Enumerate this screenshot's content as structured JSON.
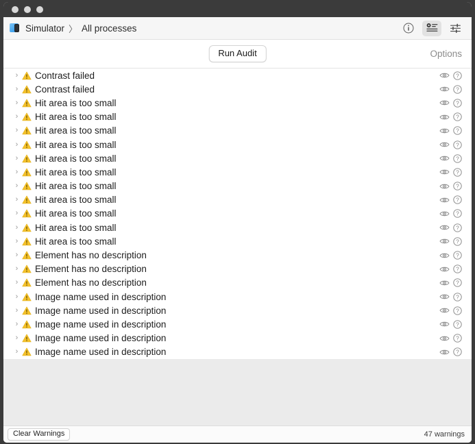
{
  "window": {
    "traffic_lights": [
      "close",
      "minimize",
      "zoom"
    ]
  },
  "toolbar": {
    "app_icon": "simulator-icon",
    "breadcrumb": {
      "app": "Simulator",
      "separator": "〉",
      "scope": "All processes"
    },
    "actions": [
      {
        "name": "info-icon",
        "label": "Info"
      },
      {
        "name": "inspector-icon",
        "label": "Inspector",
        "selected": true
      },
      {
        "name": "sliders-icon",
        "label": "Filters"
      }
    ]
  },
  "auditbar": {
    "run_audit_label": "Run Audit",
    "options_label": "Options"
  },
  "list": {
    "row_icon": "warning-triangle-icon",
    "disclosure_icon": "chevron-right-icon",
    "row_actions": [
      {
        "name": "eye-icon",
        "label": "Reveal"
      },
      {
        "name": "help-icon",
        "label": "Help"
      }
    ],
    "rows": [
      {
        "label": "Contrast failed"
      },
      {
        "label": "Contrast failed"
      },
      {
        "label": "Hit area is too small"
      },
      {
        "label": "Hit area is too small"
      },
      {
        "label": "Hit area is too small"
      },
      {
        "label": "Hit area is too small"
      },
      {
        "label": "Hit area is too small"
      },
      {
        "label": "Hit area is too small"
      },
      {
        "label": "Hit area is too small"
      },
      {
        "label": "Hit area is too small"
      },
      {
        "label": "Hit area is too small"
      },
      {
        "label": "Hit area is too small"
      },
      {
        "label": "Hit area is too small"
      },
      {
        "label": "Element has no description"
      },
      {
        "label": "Element has no description"
      },
      {
        "label": "Element has no description"
      },
      {
        "label": "Image name used in description"
      },
      {
        "label": "Image name used in description"
      },
      {
        "label": "Image name used in description"
      },
      {
        "label": "Image name used in description"
      },
      {
        "label": "Image name used in description"
      }
    ]
  },
  "statusbar": {
    "clear_warnings_label": "Clear Warnings",
    "warning_count": "47 warnings"
  },
  "colors": {
    "warning_yellow": "#f5c22b",
    "window_chrome": "#3b3b3b",
    "toolbar_bg": "#f6f6f6",
    "empty_area_bg": "#ebebeb"
  }
}
